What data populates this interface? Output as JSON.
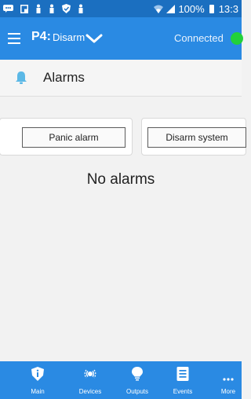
{
  "status_bar": {
    "battery_text": "100%",
    "time": "13:3",
    "icons": [
      "message-icon",
      "screenshot-icon",
      "person-icon",
      "person-icon",
      "shield-icon",
      "person-icon",
      "wifi-icon",
      "signal-icon",
      "battery-icon"
    ]
  },
  "app_bar": {
    "partition_id": "P4:",
    "partition_state": "Disarm",
    "connection_status": "Connected",
    "colors": {
      "bar": "#2a8ae3",
      "status_bar": "#1b6fc0",
      "connected": "#22d13a"
    }
  },
  "alarms_section": {
    "title": "Alarms",
    "icon": "bell-icon",
    "panic_button": "Panic alarm",
    "disarm_button": "Disarm system",
    "empty_text": "No alarms"
  },
  "bottom_nav": {
    "items": [
      {
        "label": "Main",
        "icon": "info-icon"
      },
      {
        "label": "Devices",
        "icon": "devices-icon"
      },
      {
        "label": "Outputs",
        "icon": "bulb-icon"
      },
      {
        "label": "Events",
        "icon": "events-icon"
      },
      {
        "label": "More",
        "icon": "more-icon"
      }
    ]
  }
}
